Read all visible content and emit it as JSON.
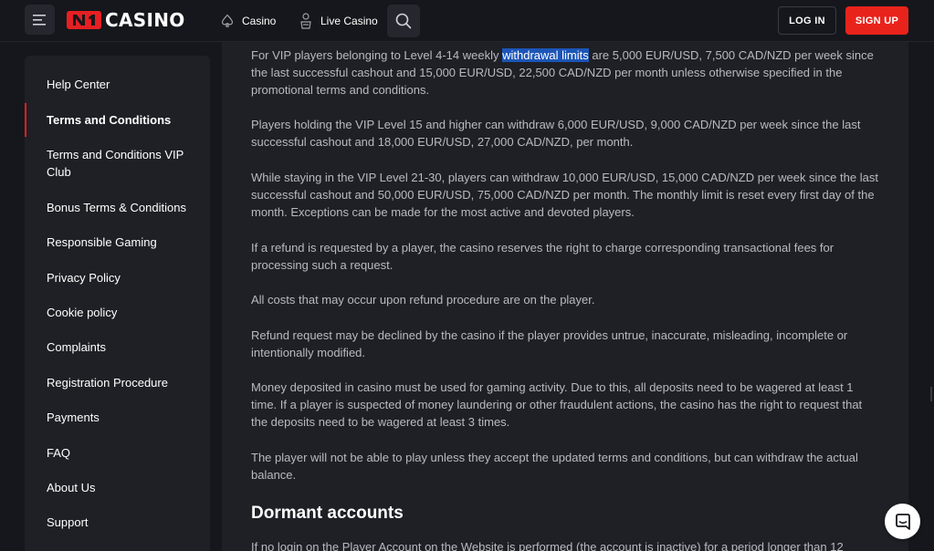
{
  "header": {
    "logo_text": "CASINO",
    "logo_badge_text": "N1",
    "nav": [
      {
        "label": "Casino",
        "icon": "spade-icon"
      },
      {
        "label": "Live Casino",
        "icon": "dealer-icon"
      }
    ],
    "login_label": "LOG IN",
    "signup_label": "SIGN UP",
    "accent_color": "#e8231c"
  },
  "sidebar": {
    "items": [
      {
        "label": "Help Center"
      },
      {
        "label": "Terms and Conditions",
        "active": true
      },
      {
        "label": "Terms and Conditions VIP Club"
      },
      {
        "label": "Bonus Terms & Conditions"
      },
      {
        "label": "Responsible Gaming"
      },
      {
        "label": "Privacy Policy"
      },
      {
        "label": "Cookie policy"
      },
      {
        "label": "Complaints"
      },
      {
        "label": "Registration Procedure"
      },
      {
        "label": "Payments"
      },
      {
        "label": "FAQ"
      },
      {
        "label": "About Us"
      },
      {
        "label": "Support"
      }
    ]
  },
  "content": {
    "p0_before": "For VIP players belonging to Level 4-14 weekly ",
    "p0_highlight": "withdrawal limits",
    "p0_after": " are 5,000 EUR/USD, 7,500 CAD/NZD per week since the last successful cashout and 15,000 EUR/USD, 22,500 CAD/NZD per month unless otherwise specified in the promotional terms and conditions.",
    "p1": "Players holding the VIP Level 15 and higher can withdraw 6,000 EUR/USD, 9,000 CAD/NZD per week since the last successful cashout and 18,000 EUR/USD, 27,000 CAD/NZD, per month.",
    "p2": "While staying in the VIP Level 21-30, players can withdraw 10,000 EUR/USD, 15,000 CAD/NZD per week since the last successful cashout and 50,000 EUR/USD, 75,000 CAD/NZD per month. The monthly limit is reset every first day of the month. Exceptions can be made for the most active and devoted players.",
    "p3": "If a refund is requested by a player, the casino reserves the right to charge corresponding transactional fees for processing such a request.",
    "p4": "All costs that may occur upon refund procedure are on the player.",
    "p5": "Refund request may be declined by the casino if the player provides untrue, inaccurate, misleading, incomplete or intentionally modified.",
    "p6": "Money deposited in casino must be used for gaming activity. Due to this, all deposits need to be wagered at least 1 time. If a player is suspected of money laundering or other fraudulent actions, the casino has the right to request that the deposits need to be wagered at least 3 times.",
    "p7": "The player will not be able to play unless they accept the updated terms and conditions, but can withdraw the actual balance.",
    "section_title": "Dormant accounts",
    "p8": "If no login on the Player Account on the Website is performed (the account is inactive) for a period longer than 12"
  }
}
